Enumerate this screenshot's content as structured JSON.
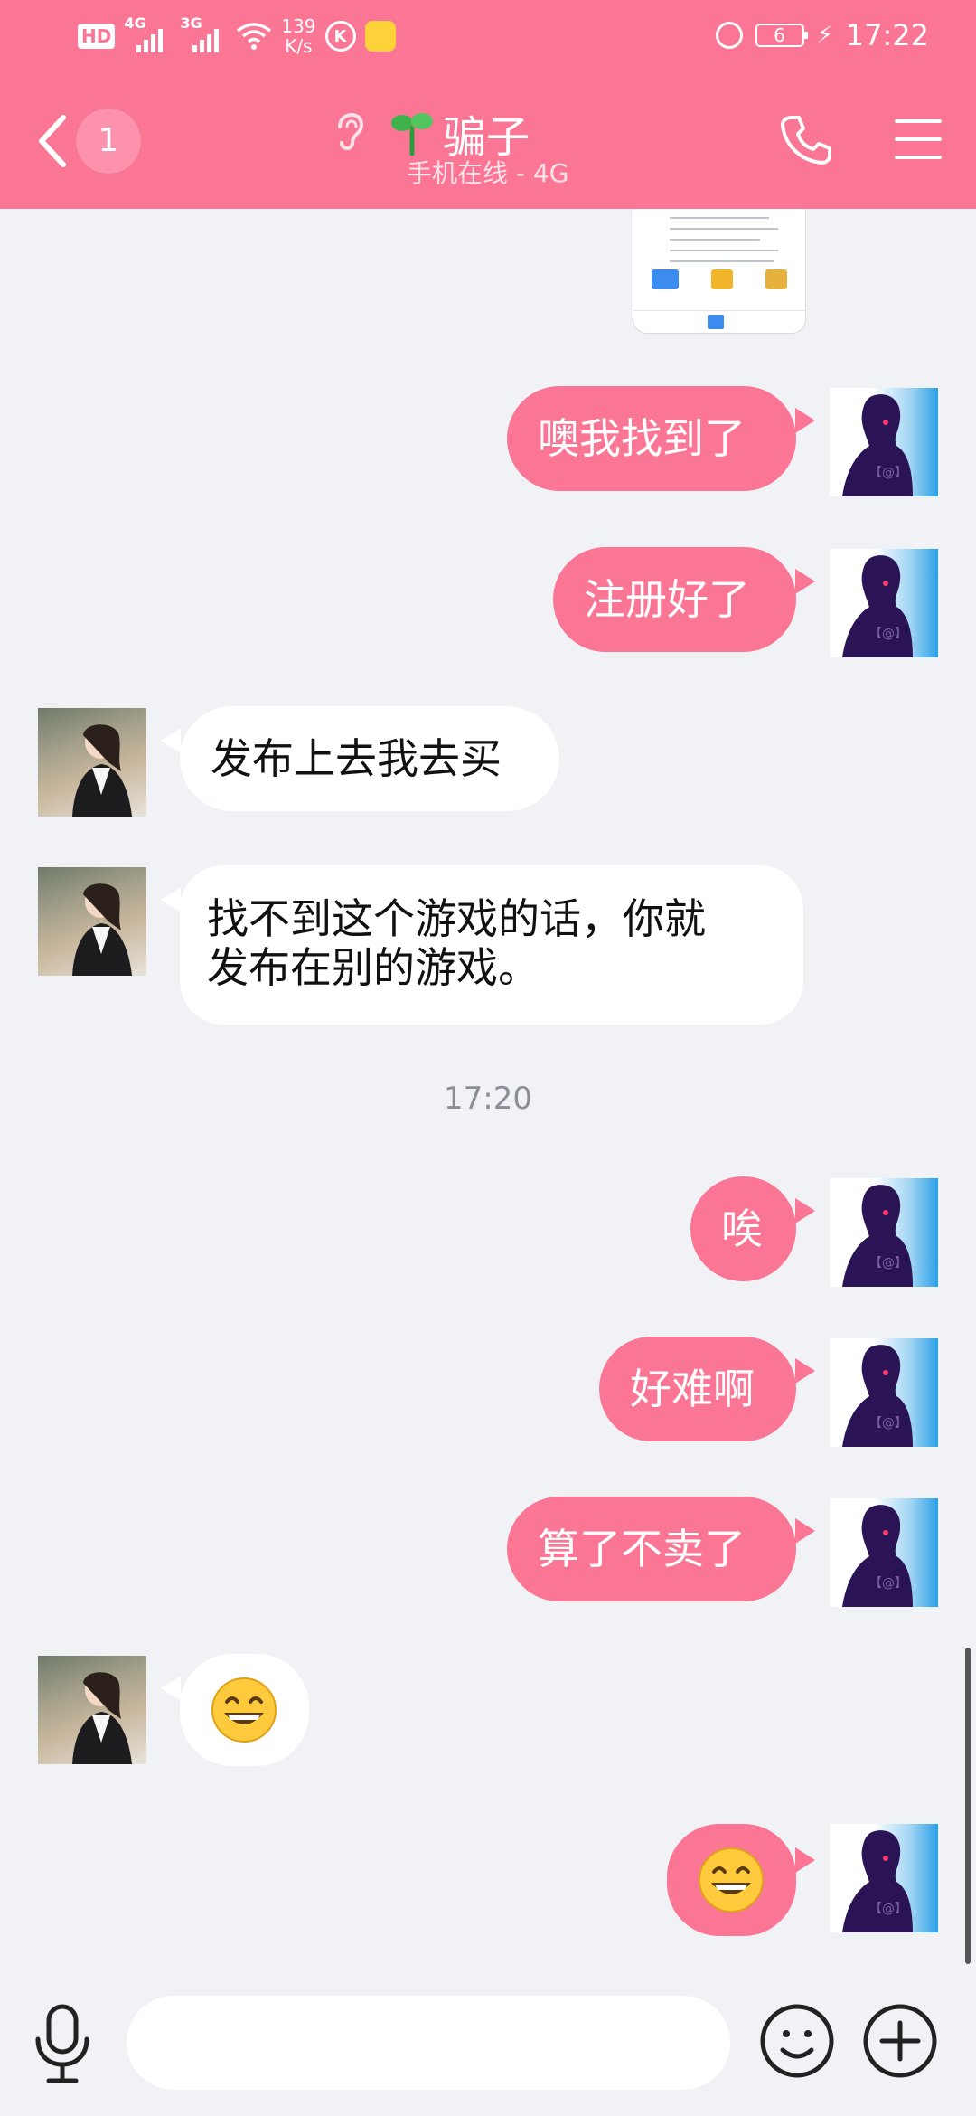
{
  "status_bar": {
    "hd": "HD",
    "net1": "4G",
    "net2": "3G",
    "speed_value": "139",
    "speed_unit": "K/s",
    "k_badge": "K",
    "battery": "6",
    "time": "17:22"
  },
  "header": {
    "unread_count": "1",
    "title": "骗子",
    "subtitle": "手机在线 - 4G"
  },
  "messages": [
    {
      "side": "out",
      "text": "噢我找到了"
    },
    {
      "side": "out",
      "text": "注册好了"
    },
    {
      "side": "in",
      "text": "发布上去我去买"
    },
    {
      "side": "in",
      "lines": [
        "找不到这个游戏的话，你就",
        "发布在别的游戏。"
      ]
    },
    {
      "side": "time",
      "text": "17:20"
    },
    {
      "side": "out",
      "text": "唉"
    },
    {
      "side": "out",
      "text": "好难啊"
    },
    {
      "side": "out",
      "text": "算了不卖了"
    },
    {
      "side": "in",
      "emoji": "grinning-face"
    },
    {
      "side": "out",
      "emoji": "grinning-face"
    }
  ],
  "avatar_me_label": "【@】",
  "input": {
    "placeholder": ""
  },
  "colors": {
    "accent": "#fb7595",
    "background": "#f1f2f6"
  }
}
